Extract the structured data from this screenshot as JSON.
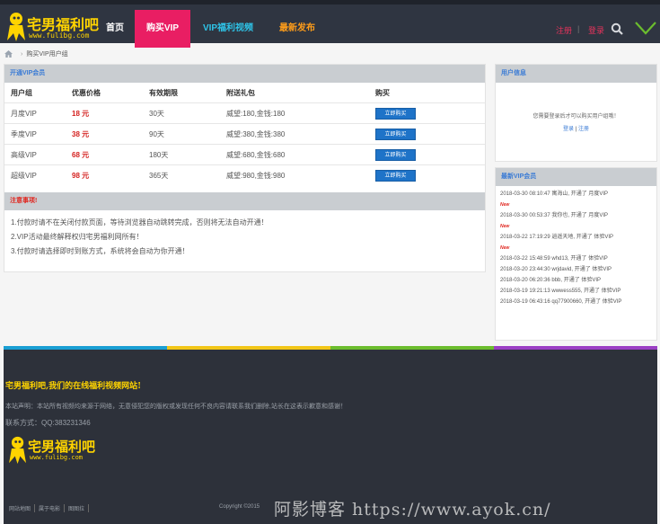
{
  "header": {
    "logo_title": "宅男福利吧",
    "logo_url": "www.fulibg.com",
    "nav": [
      "首页",
      "购买VIP",
      "VIP福利视频",
      "最新发布"
    ],
    "register": "注册",
    "separator": "|",
    "login": "登录"
  },
  "breadcrumb": {
    "current": "购买VIP用户组"
  },
  "plans": {
    "title": "开通VIP会员",
    "headers": [
      "用户组",
      "优惠价格",
      "有效期限",
      "附送礼包",
      "购买"
    ],
    "rows": [
      {
        "group": "月度VIP",
        "price": "18 元",
        "period": "30天",
        "gift": "威望:180,金钱:180",
        "buy": "立即购买"
      },
      {
        "group": "季度VIP",
        "price": "38 元",
        "period": "90天",
        "gift": "威望:380,金钱:380",
        "buy": "立即购买"
      },
      {
        "group": "高级VIP",
        "price": "68 元",
        "period": "180天",
        "gift": "威望:680,金钱:680",
        "buy": "立即购买"
      },
      {
        "group": "超级VIP",
        "price": "98 元",
        "period": "365天",
        "gift": "威望:980,金钱:980",
        "buy": "立即购买"
      }
    ]
  },
  "notice": {
    "title": "注意事项!",
    "items": [
      "1.付款时请不在关闭付款页面，等待浏览器自动跳转完成，否则将无法自动开通！",
      "2.VIP活动最终解释权归宅男福利网所有！",
      "3.付款时请选择即时到账方式，系统将会自动为你开通！"
    ]
  },
  "sidebar": {
    "user_title": "用户信息",
    "user_message": "您需要登录后才可以购买用户组哦！",
    "login_link": "登录",
    "link_sep": "|",
    "register_link": "注册",
    "latest_title": "最新VIP会员",
    "latest": [
      {
        "text": "2018-03-30 08:10:47 寓海山, 开通了 月度VIP",
        "badge": "New"
      },
      {
        "text": "2018-03-30 00:53:37 我你也, 开通了 月度VIP",
        "badge": "New"
      },
      {
        "text": "2018-03-22 17:19:29 逍遥天地, 开通了 体验VIP",
        "badge": "New"
      },
      {
        "text": "2018-03-22 15:48:59 whd13, 开通了 体验VIP",
        "badge": ""
      },
      {
        "text": "2018-03-20 23:44:30 wrjdavid, 开通了 体验VIP",
        "badge": ""
      },
      {
        "text": "2018-03-20 06:20:36 bbb, 开通了 体验VIP",
        "badge": ""
      },
      {
        "text": "2018-03-19 19:21:13 wwwess555, 开通了 体验VIP",
        "badge": ""
      },
      {
        "text": "2018-03-19 06:43:16 qq77900660, 开通了 体验VIP",
        "badge": ""
      }
    ]
  },
  "footer": {
    "title": "宅男福利吧,我们的在线福利视频网站!",
    "desc": "本站声明：本站所有视频均来源于网络，无意侵犯您的版权或发现任何不良内容请联系我们删除,站长在这表示歉意和感谢！",
    "contact": "联系方式：QQ:383231346",
    "logo_title": "宅男福利吧",
    "logo_url": "www.fulibg.com",
    "links": [
      "网站地图",
      "属于电影",
      "图图拉"
    ],
    "copyright": "Copyright ©2015"
  },
  "watermark": "阿影博客 https://www.ayok.cn/",
  "colors": {
    "header_bg": "#2f3541",
    "nav_vip_bg": "#e91e63",
    "nav_video": "#2ec4e8",
    "nav_new": "#ff9d1a",
    "price_red": "#d4201e",
    "button_blue": "#1e73c8",
    "brand_yellow": "#ffd400"
  }
}
